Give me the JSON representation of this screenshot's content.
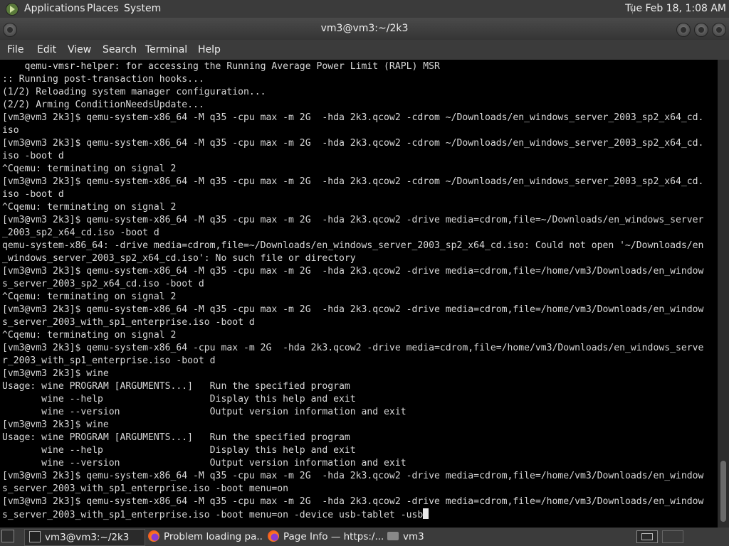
{
  "top_panel": {
    "menus": [
      "Applications",
      "Places",
      "System"
    ],
    "clock": "Tue Feb 18,  1:08 AM"
  },
  "window": {
    "title": "vm3@vm3:~/2k3"
  },
  "menubar": [
    "File",
    "Edit",
    "View",
    "Search",
    "Terminal",
    "Help"
  ],
  "terminal": {
    "lines": [
      "    qemu-vmsr-helper: for accessing the Running Average Power Limit (RAPL) MSR",
      ":: Running post-transaction hooks...",
      "(1/2) Reloading system manager configuration...",
      "(2/2) Arming ConditionNeedsUpdate...",
      "[vm3@vm3 2k3]$ qemu-system-x86_64 -M q35 -cpu max -m 2G  -hda 2k3.qcow2 -cdrom ~/Downloads/en_windows_server_2003_sp2_x64_cd.",
      "iso",
      "[vm3@vm3 2k3]$ qemu-system-x86_64 -M q35 -cpu max -m 2G  -hda 2k3.qcow2 -cdrom ~/Downloads/en_windows_server_2003_sp2_x64_cd.",
      "iso -boot d",
      "^Cqemu: terminating on signal 2",
      "[vm3@vm3 2k3]$ qemu-system-x86_64 -M q35 -cpu max -m 2G  -hda 2k3.qcow2 -cdrom ~/Downloads/en_windows_server_2003_sp2_x64_cd.",
      "iso -boot d",
      "^Cqemu: terminating on signal 2",
      "[vm3@vm3 2k3]$ qemu-system-x86_64 -M q35 -cpu max -m 2G  -hda 2k3.qcow2 -drive media=cdrom,file=~/Downloads/en_windows_server",
      "_2003_sp2_x64_cd.iso -boot d",
      "qemu-system-x86_64: -drive media=cdrom,file=~/Downloads/en_windows_server_2003_sp2_x64_cd.iso: Could not open '~/Downloads/en",
      "_windows_server_2003_sp2_x64_cd.iso': No such file or directory",
      "[vm3@vm3 2k3]$ qemu-system-x86_64 -M q35 -cpu max -m 2G  -hda 2k3.qcow2 -drive media=cdrom,file=/home/vm3/Downloads/en_window",
      "s_server_2003_sp2_x64_cd.iso -boot d",
      "^Cqemu: terminating on signal 2",
      "[vm3@vm3 2k3]$ qemu-system-x86_64 -M q35 -cpu max -m 2G  -hda 2k3.qcow2 -drive media=cdrom,file=/home/vm3/Downloads/en_window",
      "s_server_2003_with_sp1_enterprise.iso -boot d",
      "^Cqemu: terminating on signal 2",
      "[vm3@vm3 2k3]$ qemu-system-x86_64 -cpu max -m 2G  -hda 2k3.qcow2 -drive media=cdrom,file=/home/vm3/Downloads/en_windows_serve",
      "r_2003_with_sp1_enterprise.iso -boot d",
      "[vm3@vm3 2k3]$ wine",
      "Usage: wine PROGRAM [ARGUMENTS...]   Run the specified program",
      "       wine --help                   Display this help and exit",
      "       wine --version                Output version information and exit",
      "[vm3@vm3 2k3]$ wine",
      "Usage: wine PROGRAM [ARGUMENTS...]   Run the specified program",
      "       wine --help                   Display this help and exit",
      "       wine --version                Output version information and exit",
      "[vm3@vm3 2k3]$ qemu-system-x86_64 -M q35 -cpu max -m 2G  -hda 2k3.qcow2 -drive media=cdrom,file=/home/vm3/Downloads/en_window",
      "s_server_2003_with_sp1_enterprise.iso -boot menu=on",
      "[vm3@vm3 2k3]$ qemu-system-x86_64 -M q35 -cpu max -m 2G  -hda 2k3.qcow2 -drive media=cdrom,file=/home/vm3/Downloads/en_window",
      "s_server_2003_with_sp1_enterprise.iso -boot menu=on -device usb-tablet -usb"
    ]
  },
  "taskbar": {
    "tasks": [
      {
        "label": "vm3@vm3:~/2k3",
        "icon": "terminal-icon"
      },
      {
        "label": "Problem loading pa...",
        "icon": "firefox-icon"
      },
      {
        "label": "Page Info — https:/...",
        "icon": "firefox-icon"
      },
      {
        "label": "vm3",
        "icon": "folder-icon"
      }
    ]
  }
}
